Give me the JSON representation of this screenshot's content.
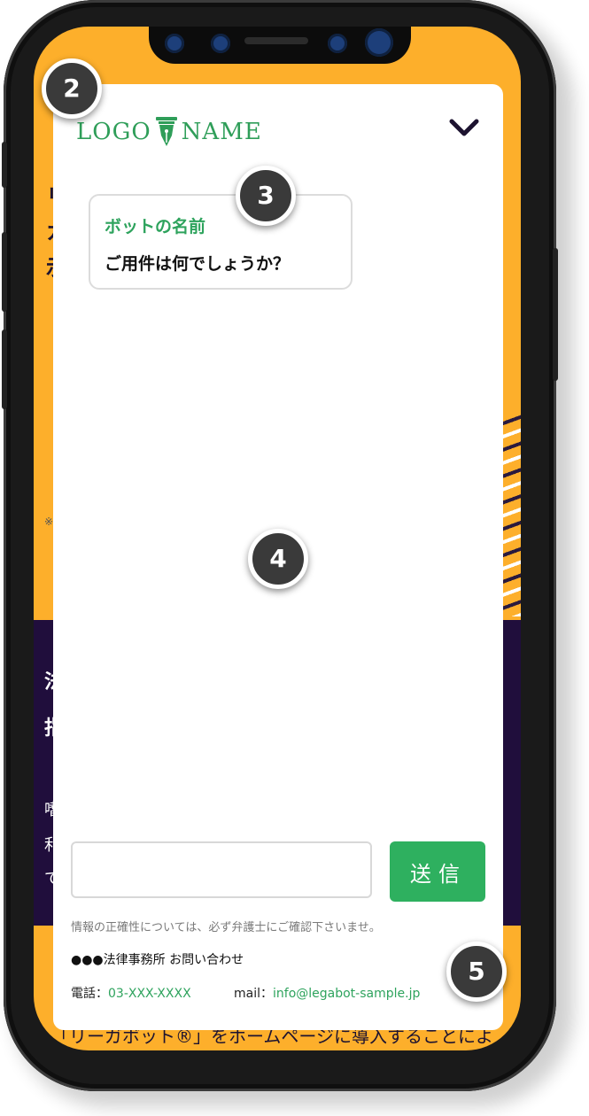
{
  "background_page": {
    "fragment_1": "リ",
    "fragment_2": "カ",
    "fragment_3": "示",
    "note_mark": "※",
    "dark_fragment_1": "法",
    "dark_fragment_2": "指",
    "dark_fragment_3": "嗜",
    "dark_fragment_4": "利",
    "dark_fragment_5": "で",
    "bottom_text": "「リーガボット®」をホームページに導入することによ"
  },
  "chat": {
    "logo": {
      "left": "LOGO",
      "right": "NAME"
    },
    "collapse_icon": "chevron-down-icon",
    "bot_name": "ボットの名前",
    "bot_message": "ご用件は何でしょうか？",
    "input_value": "",
    "send_label": "送信",
    "disclaimer": "情報の正確性については、必ず弁護士にご確認下さいませ。",
    "contact_title": "●●●法律事務所 お問い合わせ",
    "phone_label": "電話：",
    "phone_value": "03-XXX-XXXX",
    "mail_label": "mail：",
    "mail_value": "info@legabot-sample.jp"
  },
  "markers": {
    "m2": "2",
    "m3": "3",
    "m4": "4",
    "m5": "5"
  },
  "colors": {
    "accent_green": "#2eb05f",
    "page_orange": "#fdaf2b",
    "page_dark": "#200e3c"
  }
}
